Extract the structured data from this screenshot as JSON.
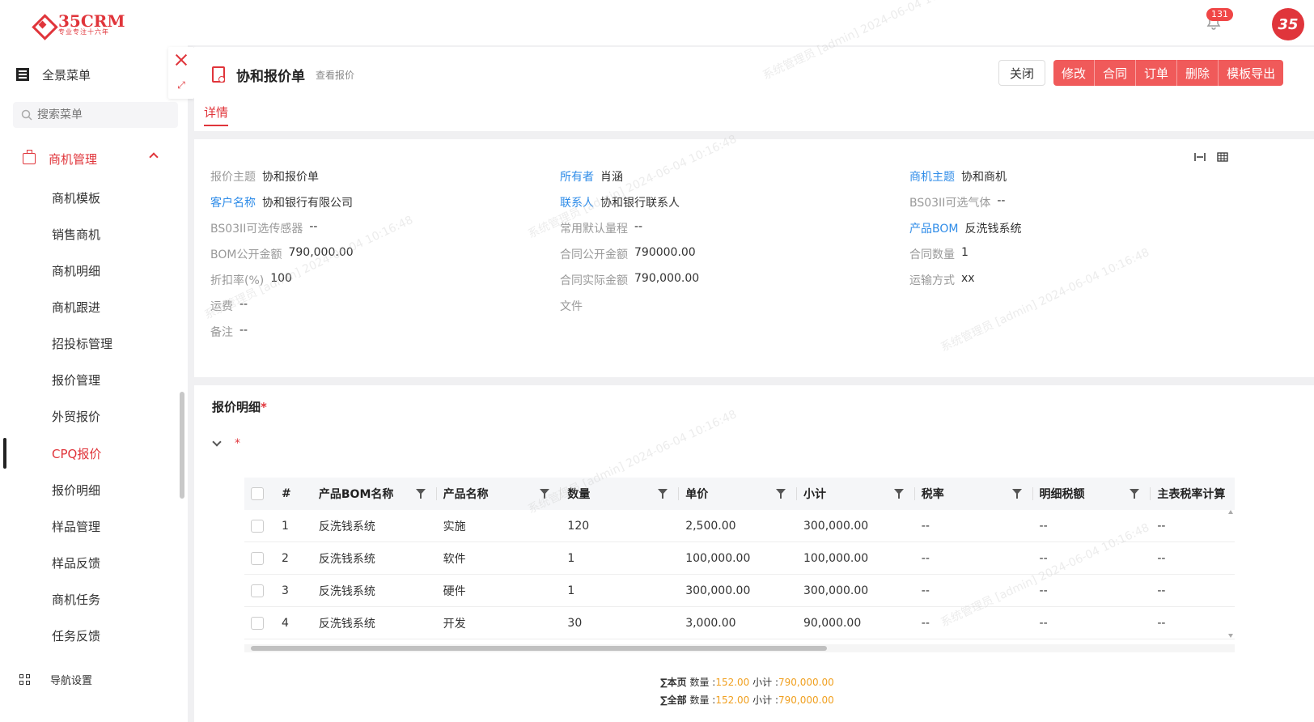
{
  "brand": {
    "name": "35CRM",
    "tagline": "专业专注十六年"
  },
  "notifications": {
    "count": "131"
  },
  "avatar": {
    "text": "35"
  },
  "sidebar": {
    "menu_all": "全景菜单",
    "search_placeholder": "搜索菜单",
    "group": "商机管理",
    "items": [
      "商机模板",
      "销售商机",
      "商机明细",
      "商机跟进",
      "招投标管理",
      "报价管理",
      "外贸报价",
      "CPQ报价",
      "报价明细",
      "样品管理",
      "样品反馈",
      "商机任务",
      "任务反馈"
    ],
    "active_item": "CPQ报价",
    "nav_settings": "导航设置"
  },
  "header": {
    "title": "协和报价单",
    "subtitle": "查看报价",
    "close": "关闭",
    "actions": [
      "修改",
      "合同",
      "订单",
      "删除",
      "模板导出"
    ],
    "tab": "详情"
  },
  "details": {
    "col1": [
      {
        "label": "报价主题",
        "value": "协和报价单",
        "link": false
      },
      {
        "label": "客户名称",
        "value": "协和银行有限公司",
        "link": true
      },
      {
        "label": "BS03II可选传感器",
        "value": "--",
        "link": false
      },
      {
        "label": "BOM公开金额",
        "value": "790,000.00",
        "link": false
      },
      {
        "label": "折扣率(%)",
        "value": "100",
        "link": false
      },
      {
        "label": "运费",
        "value": "--",
        "link": false
      },
      {
        "label": "备注",
        "value": "--",
        "link": false
      }
    ],
    "col2": [
      {
        "label": "所有者",
        "value": "肖涵",
        "link": true
      },
      {
        "label": "联系人",
        "value": "协和银行联系人",
        "link": true
      },
      {
        "label": "常用默认量程",
        "value": "--",
        "link": false
      },
      {
        "label": "合同公开金额",
        "value": "790000.00",
        "link": false
      },
      {
        "label": "合同实际金额",
        "value": "790,000.00",
        "link": false
      },
      {
        "label": "文件",
        "value": "",
        "link": false
      }
    ],
    "col3": [
      {
        "label": "商机主题",
        "value": "协和商机",
        "link": true
      },
      {
        "label": "BS03II可选气体",
        "value": "--",
        "link": false
      },
      {
        "label": "产品BOM",
        "value": "反洗钱系统",
        "link": true
      },
      {
        "label": "合同数量",
        "value": "1",
        "link": false
      },
      {
        "label": "运输方式",
        "value": "xx",
        "link": false
      }
    ]
  },
  "items": {
    "title": "报价明细",
    "required_mark": "*",
    "columns": [
      "#",
      "产品BOM名称",
      "产品名称",
      "数量",
      "单价",
      "小计",
      "税率",
      "明细税额",
      "主表税率计算"
    ],
    "rows": [
      [
        "1",
        "反洗钱系统",
        "实施",
        "120",
        "2,500.00",
        "300,000.00",
        "--",
        "--",
        "--"
      ],
      [
        "2",
        "反洗钱系统",
        "软件",
        "1",
        "100,000.00",
        "100,000.00",
        "--",
        "--",
        "--"
      ],
      [
        "3",
        "反洗钱系统",
        "硬件",
        "1",
        "300,000.00",
        "300,000.00",
        "--",
        "--",
        "--"
      ],
      [
        "4",
        "反洗钱系统",
        "开发",
        "30",
        "3,000.00",
        "90,000.00",
        "--",
        "--",
        "--"
      ]
    ],
    "summary_page": {
      "label": "∑本页",
      "qty_label": "数量 :",
      "qty": "152.00",
      "sub_label": "小计 :",
      "sub": "790,000.00"
    },
    "summary_all": {
      "label": "∑全部",
      "qty_label": "数量 :",
      "qty": "152.00",
      "sub_label": "小计 :",
      "sub": "790,000.00"
    }
  },
  "watermark": "系统管理员 [admin] 2024-06-04 10:16:48",
  "colors": {
    "accent": "#e0353b",
    "link": "#2f8ce8",
    "button": "#f05a5a",
    "summary_num": "#f0a020"
  }
}
